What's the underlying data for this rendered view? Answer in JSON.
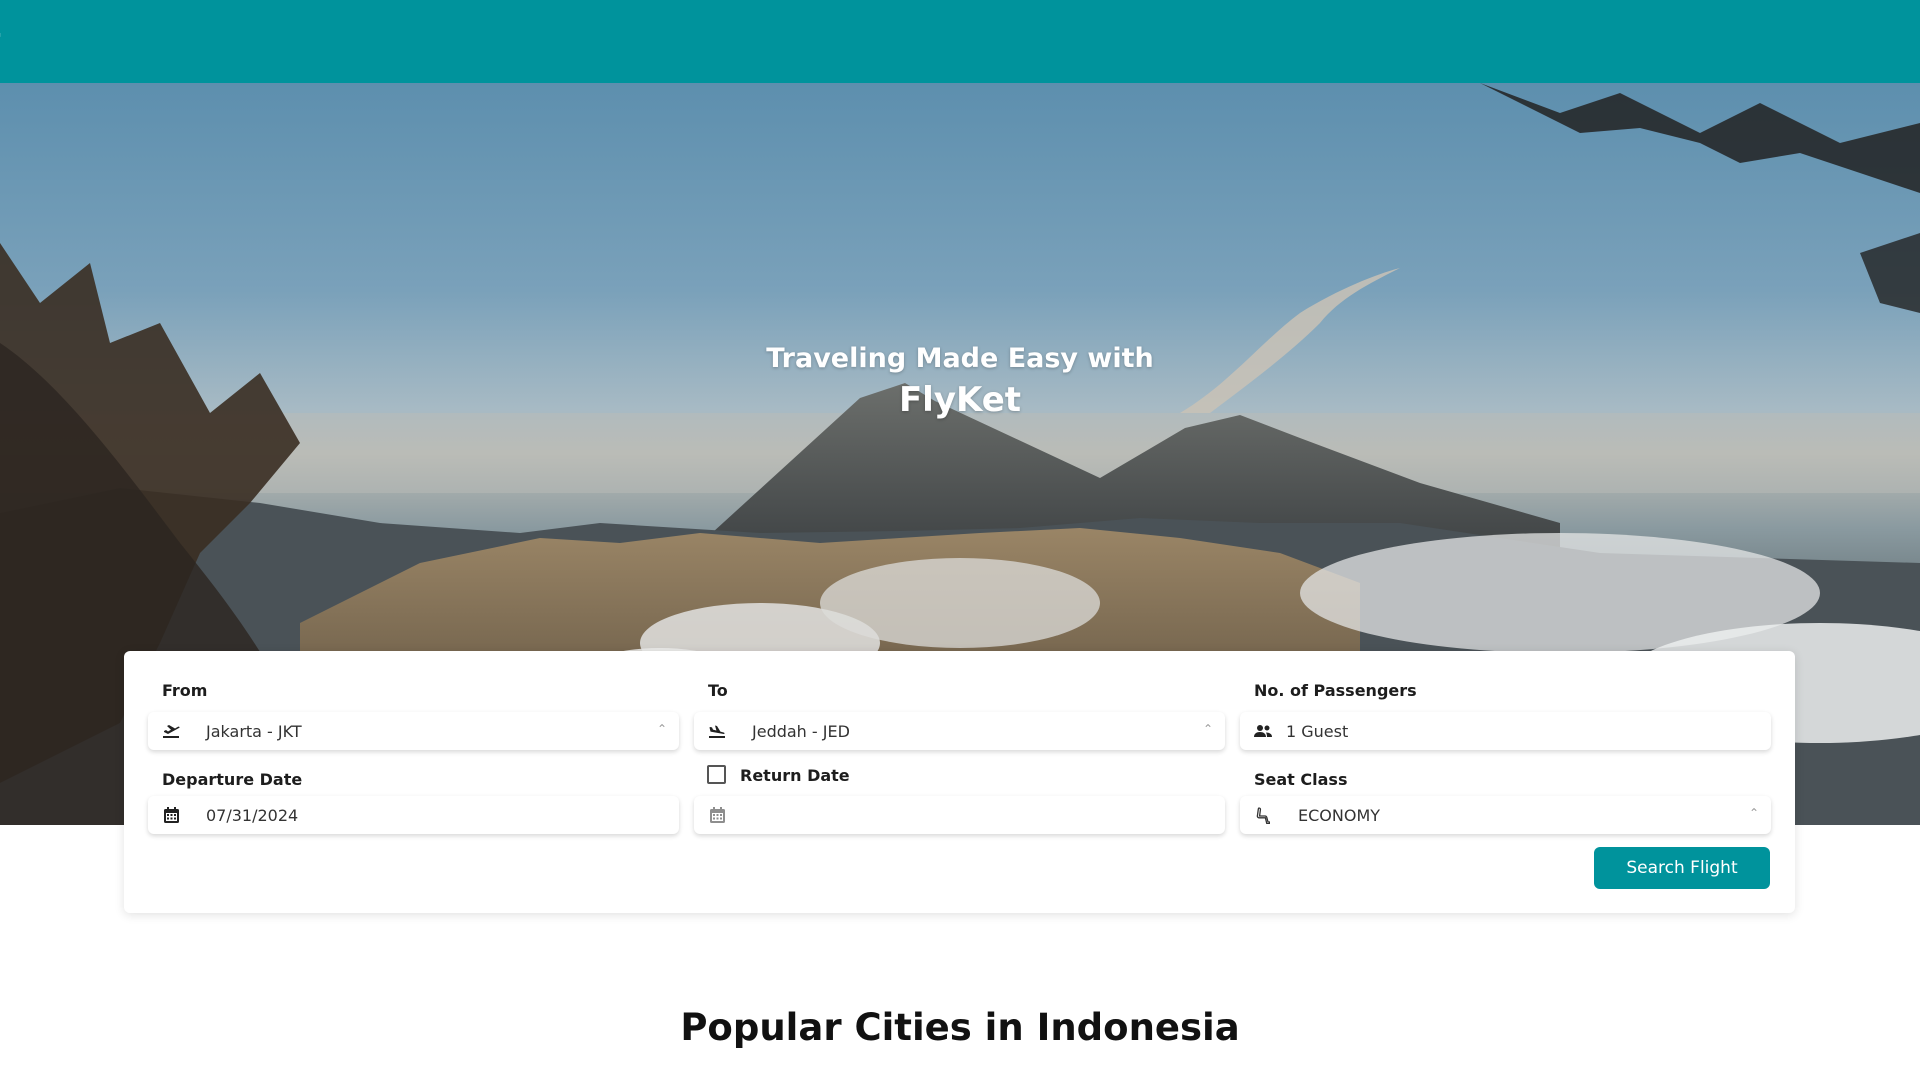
{
  "header": {
    "brand": "t",
    "bg_color": "#00939c"
  },
  "hero": {
    "line1": "Traveling Made Easy with",
    "line2": "FlyKet"
  },
  "form": {
    "from": {
      "label": "From",
      "value": "Jakarta - JKT",
      "icon": "plane-takeoff-icon"
    },
    "to": {
      "label": "To",
      "value": "Jeddah - JED",
      "icon": "plane-landing-icon"
    },
    "passengers": {
      "label": "No. of Passengers",
      "value": "1 Guest",
      "icon": "users-icon"
    },
    "departure": {
      "label": "Departure Date",
      "value": "07/31/2024",
      "icon": "calendar-icon"
    },
    "return": {
      "label": "Return Date",
      "value": "",
      "checked": false,
      "icon": "calendar-icon"
    },
    "seat_class": {
      "label": "Seat Class",
      "value": "ECONOMY",
      "icon": "seat-icon"
    },
    "search_label": "Search Flight"
  },
  "section": {
    "title": "Popular Cities in Indonesia"
  }
}
